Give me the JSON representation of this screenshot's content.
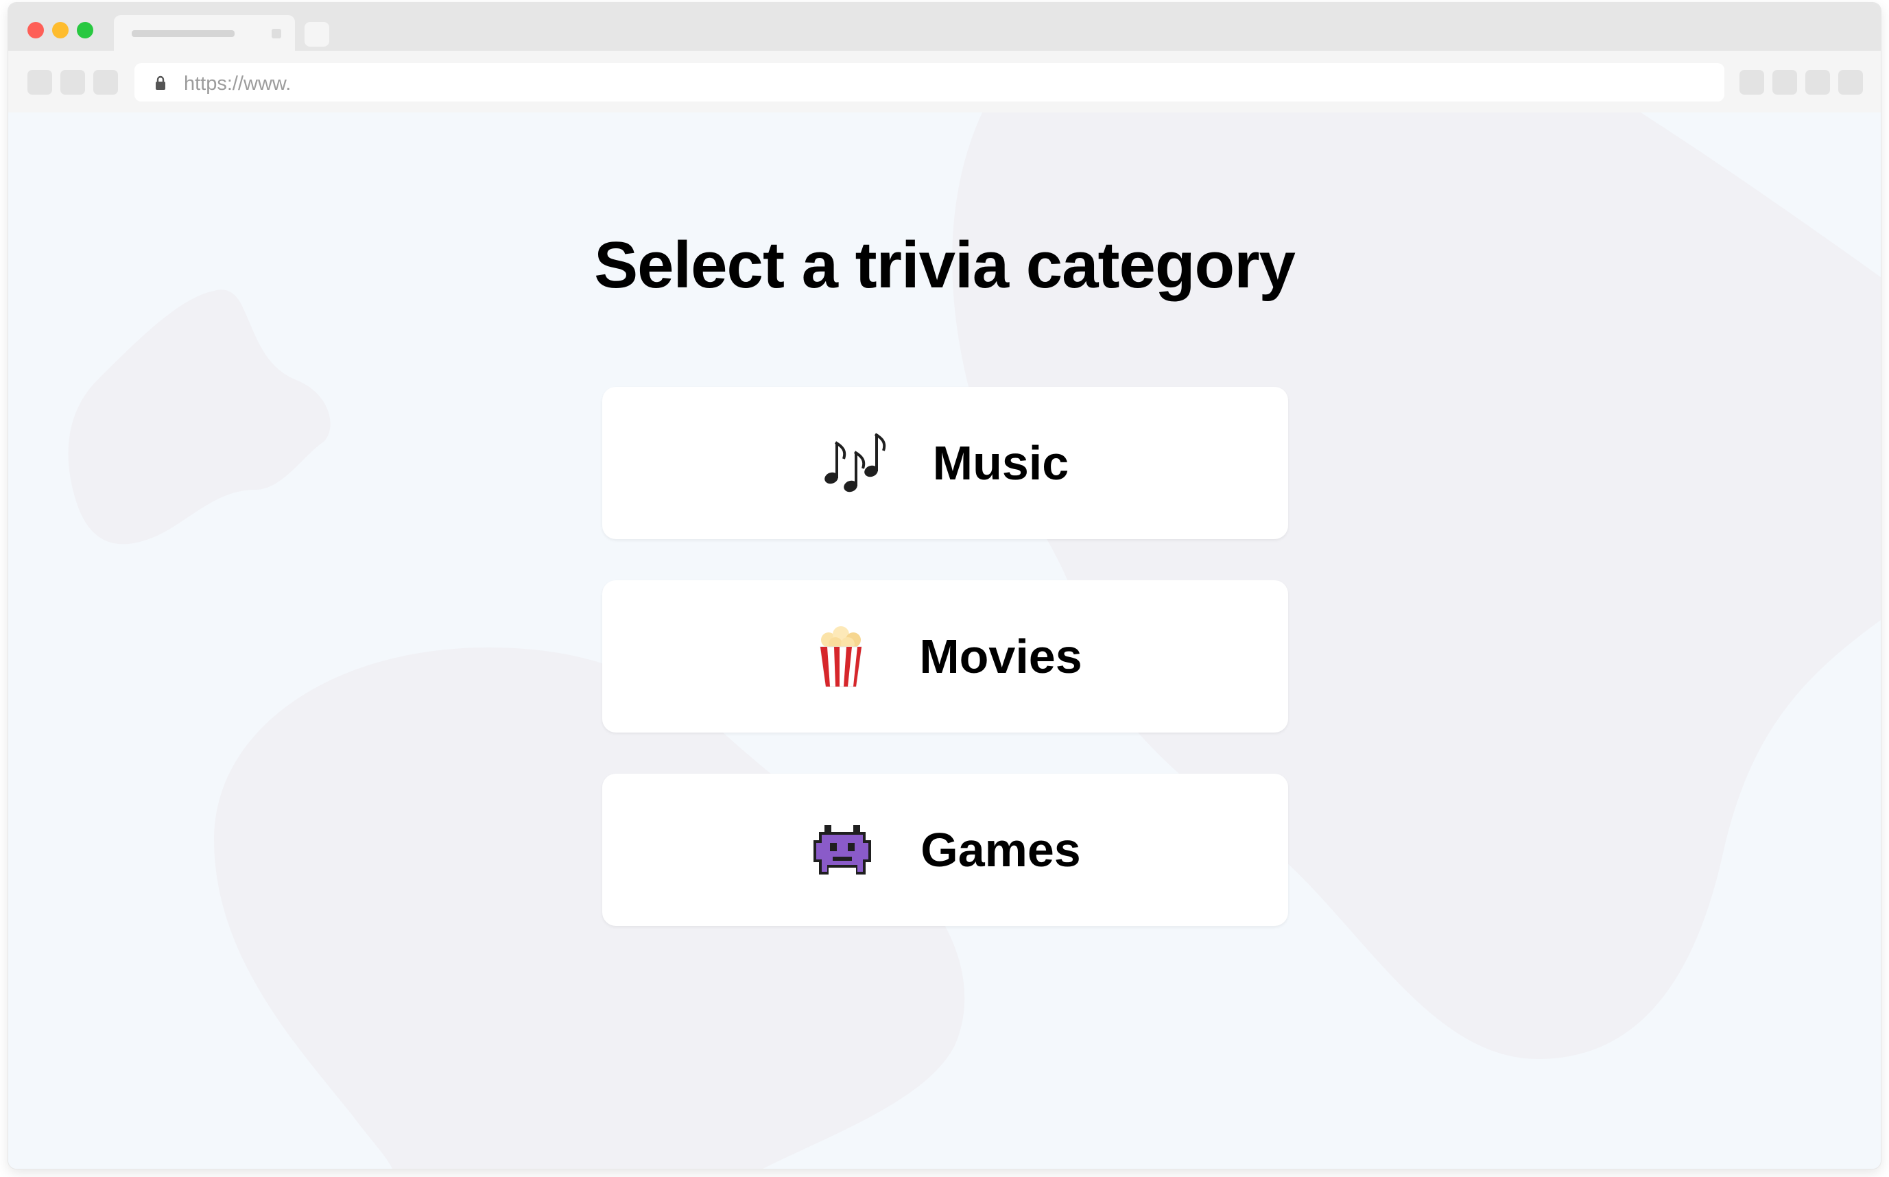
{
  "browser": {
    "url": "https://www."
  },
  "page": {
    "title": "Select a trivia category",
    "categories": [
      {
        "label": "Music",
        "icon": "musical-notes-icon"
      },
      {
        "label": "Movies",
        "icon": "popcorn-icon"
      },
      {
        "label": "Games",
        "icon": "alien-monster-icon"
      }
    ]
  },
  "colors": {
    "background": "#f4f8fc",
    "blob": "#f1f1f5",
    "card": "#ffffff",
    "text": "#000000"
  }
}
